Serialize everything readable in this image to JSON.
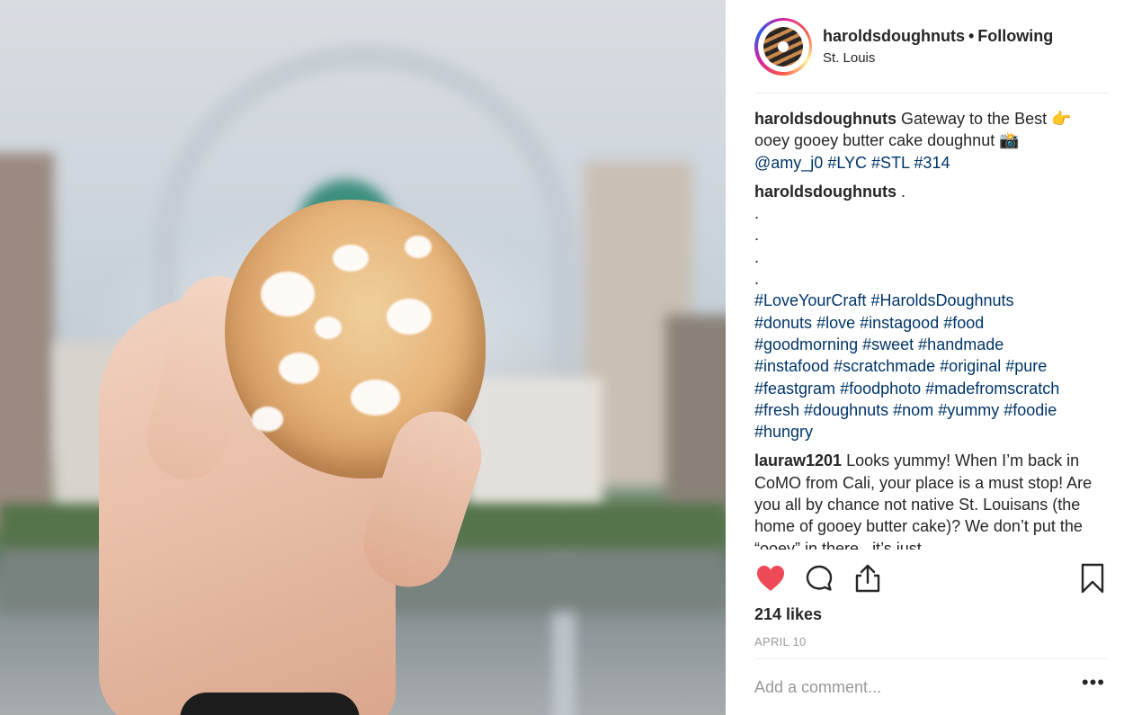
{
  "header": {
    "username": "haroldsdoughnuts",
    "separator": "•",
    "follow_state": "Following",
    "location": "St. Louis"
  },
  "caption": {
    "username": "haroldsdoughnuts",
    "text_part1": "Gateway to the Best",
    "emoji1": "👉",
    "text_part2": "ooey gooey butter cake doughnut",
    "emoji2": "📸",
    "mention": "@amy_j0",
    "tags": [
      "#LYC",
      "#STL",
      "#314"
    ]
  },
  "second_comment": {
    "username": "haroldsdoughnuts",
    "text": ".",
    "dots": [
      ".",
      ".",
      ".",
      "."
    ],
    "hashtag_lines": [
      [
        "#LoveYourCraft",
        "#HaroldsDoughnuts"
      ],
      [
        "#donuts",
        "#love",
        "#instagood",
        "#food"
      ],
      [
        "#goodmorning",
        "#sweet",
        "#handmade"
      ],
      [
        "#instafood",
        "#scratchmade",
        "#original",
        "#pure"
      ],
      [
        "#feastgram",
        "#foodphoto",
        "#madefromscratch"
      ],
      [
        "#fresh",
        "#doughnuts",
        "#nom",
        "#yummy",
        "#foodie"
      ],
      [
        "#hungry"
      ]
    ]
  },
  "third_comment": {
    "username": "lauraw1201",
    "text": "Looks yummy! When I’m back in CoMO from Cali, your place is a must stop! Are you all by chance not native St. Louisans (the home of gooey butter cake)? We don’t put the “ooey” in there...it’s just"
  },
  "actions": {
    "like_icon": "heart-filled-icon",
    "comment_icon": "comment-icon",
    "share_icon": "share-icon",
    "save_icon": "bookmark-icon",
    "like_color": "#ed4956"
  },
  "likes": "214 likes",
  "date": "APRIL 10",
  "add_comment": {
    "placeholder": "Add a comment...",
    "more_label": "•••"
  }
}
